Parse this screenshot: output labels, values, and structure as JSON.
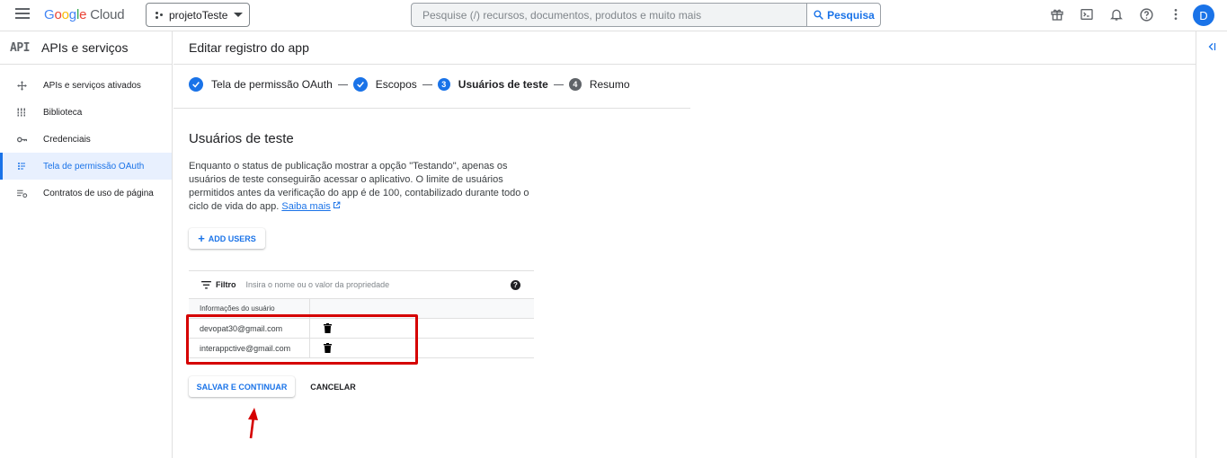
{
  "topbar": {
    "logo": {
      "g": "G",
      "o1": "o",
      "o2": "o",
      "g2": "g",
      "l": "l",
      "e": "e",
      "cloud": "Cloud"
    },
    "project": "projetoTeste",
    "search_placeholder": "Pesquise (/) recursos, documentos, produtos e muito mais",
    "search_button": "Pesquisa",
    "avatar_initial": "D",
    "icons": [
      "gift-icon",
      "terminal-icon",
      "bell-icon",
      "help-icon",
      "more-vert-icon"
    ]
  },
  "sidebar": {
    "badge": "API",
    "title": "APIs e serviços",
    "items": [
      {
        "label": "APIs e serviços ativados",
        "icon": "move-icon"
      },
      {
        "label": "Biblioteca",
        "icon": "library-icon"
      },
      {
        "label": "Credenciais",
        "icon": "key-icon"
      },
      {
        "label": "Tela de permissão OAuth",
        "icon": "consent-icon",
        "active": true
      },
      {
        "label": "Contratos de uso de página",
        "icon": "settings-list-icon"
      }
    ]
  },
  "main": {
    "title": "Editar registro do app",
    "steps": [
      {
        "label": "Tela de permissão OAuth",
        "state": "done"
      },
      {
        "label": "Escopos",
        "state": "done"
      },
      {
        "label": "Usuários de teste",
        "state": "current",
        "num": "3"
      },
      {
        "label": "Resumo",
        "state": "pending",
        "num": "4"
      }
    ],
    "section_title": "Usuários de teste",
    "description": "Enquanto o status de publicação mostrar a opção \"Testando\", apenas os usuários de teste conseguirão acessar o aplicativo. O limite de usuários permitidos antes da verificação do app é de 100, contabilizado durante todo o ciclo de vida do app.",
    "learn_more": "Saiba mais",
    "add_users": "ADD USERS",
    "filter_label": "Filtro",
    "filter_placeholder": "Insira o nome ou o valor da propriedade",
    "column_header": "Informações do usuário",
    "users": [
      {
        "email": "devopat30@gmail.com"
      },
      {
        "email": "interappctive@gmail.com"
      }
    ],
    "save_button": "SALVAR E CONTINUAR",
    "cancel_button": "CANCELAR"
  },
  "colors": {
    "accent": "#1a73e8",
    "annotation": "#d50000"
  }
}
